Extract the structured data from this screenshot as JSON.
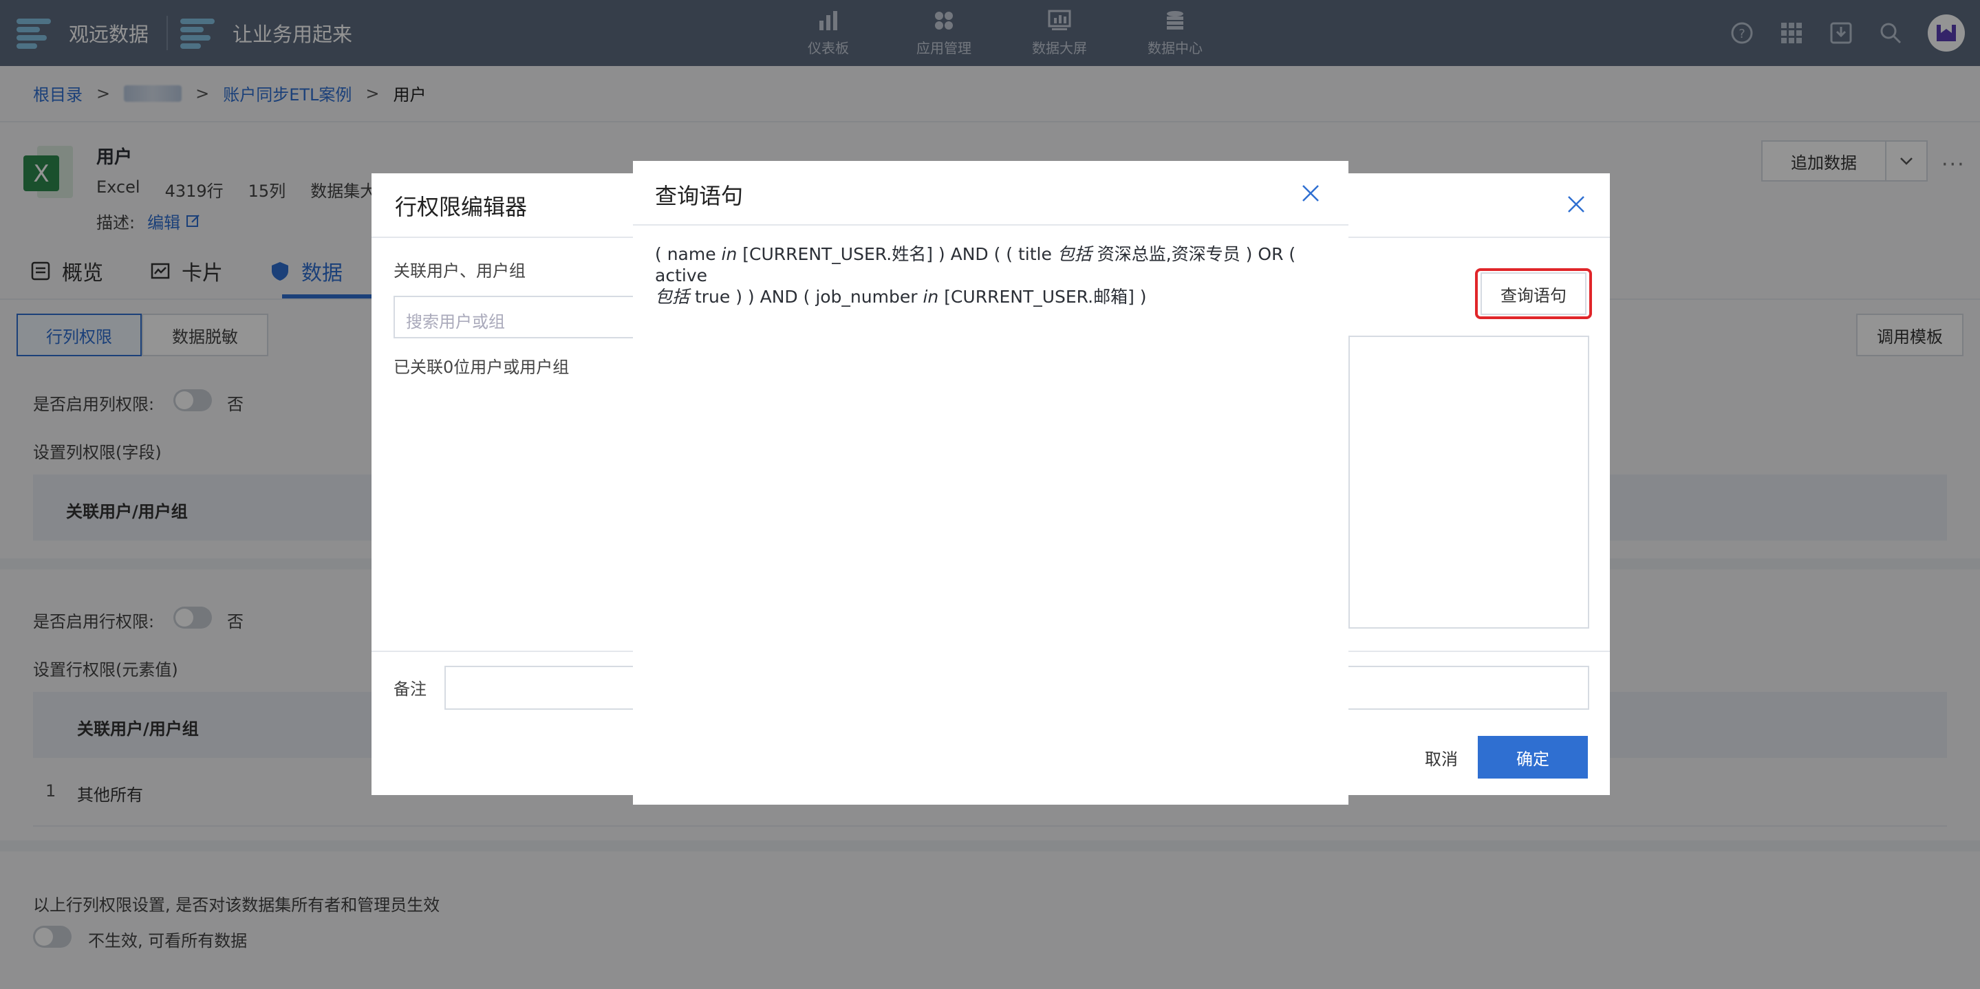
{
  "topbar": {
    "brand": "观远数据",
    "slogan": "让业务用起来",
    "nav": [
      {
        "label": "仪表板",
        "icon": "bar-chart-icon"
      },
      {
        "label": "应用管理",
        "icon": "apps-icon"
      },
      {
        "label": "数据大屏",
        "icon": "screen-icon"
      },
      {
        "label": "数据中心",
        "icon": "database-icon"
      }
    ],
    "right_icons": [
      "help-icon",
      "grid-icon",
      "inbox-icon",
      "search-icon",
      "avatar"
    ]
  },
  "breadcrumb": {
    "root": "根目录",
    "sep": ">",
    "folder": "账户同步ETL案例",
    "current": "用户"
  },
  "dataset": {
    "name": "用户",
    "type": "Excel",
    "rows": "4319行",
    "cols": "15列",
    "size_label": "数据集大小",
    "desc_label": "描述:",
    "edit_label": "编辑",
    "append_label": "追加数据"
  },
  "tabs": [
    {
      "label": "概览",
      "icon": "overview-icon"
    },
    {
      "label": "卡片",
      "icon": "card-icon"
    },
    {
      "label": "数据",
      "icon": "shield-icon"
    }
  ],
  "subtabs": {
    "active": "行列权限",
    "other": "数据脱敏",
    "template": "调用模板"
  },
  "column_perm": {
    "enable_label": "是否启用列权限:",
    "enable_value": "否",
    "set_label": "设置列权限(字段)",
    "header": "关联用户/用户组"
  },
  "row_perm": {
    "enable_label": "是否启用行权限:",
    "enable_value": "否",
    "set_label": "设置行权限(元素值)",
    "header": "关联用户/用户组",
    "row_index": "1",
    "row_name": "其他所有"
  },
  "footer": {
    "question": "以上行列权限设置, 是否对该数据集所有者和管理员生效",
    "toggle_text": "不生效, 可看所有数据"
  },
  "editor": {
    "title": "行权限编辑器",
    "related_label": "关联用户、用户组",
    "search_placeholder": "搜索用户或组",
    "related_count": "已关联0位用户或用户组",
    "query_button": "查询语句",
    "note_label": "备注",
    "cancel": "取消",
    "ok": "确定"
  },
  "query_modal": {
    "title": "查询语句",
    "p1": "( name ",
    "op_in": "in",
    "p2": " [CURRENT_USER.姓名] ) AND ( ( title ",
    "op_contains": "包括",
    "p3": " 资深总监,资深专员 ) OR ( active",
    "p4": " true ) ) AND ( job_number ",
    "p5": " [CURRENT_USER.邮箱] )"
  },
  "colors": {
    "topbar": "#5d6b80",
    "accent": "#2f6fd1",
    "highlight": "#e0262a"
  }
}
